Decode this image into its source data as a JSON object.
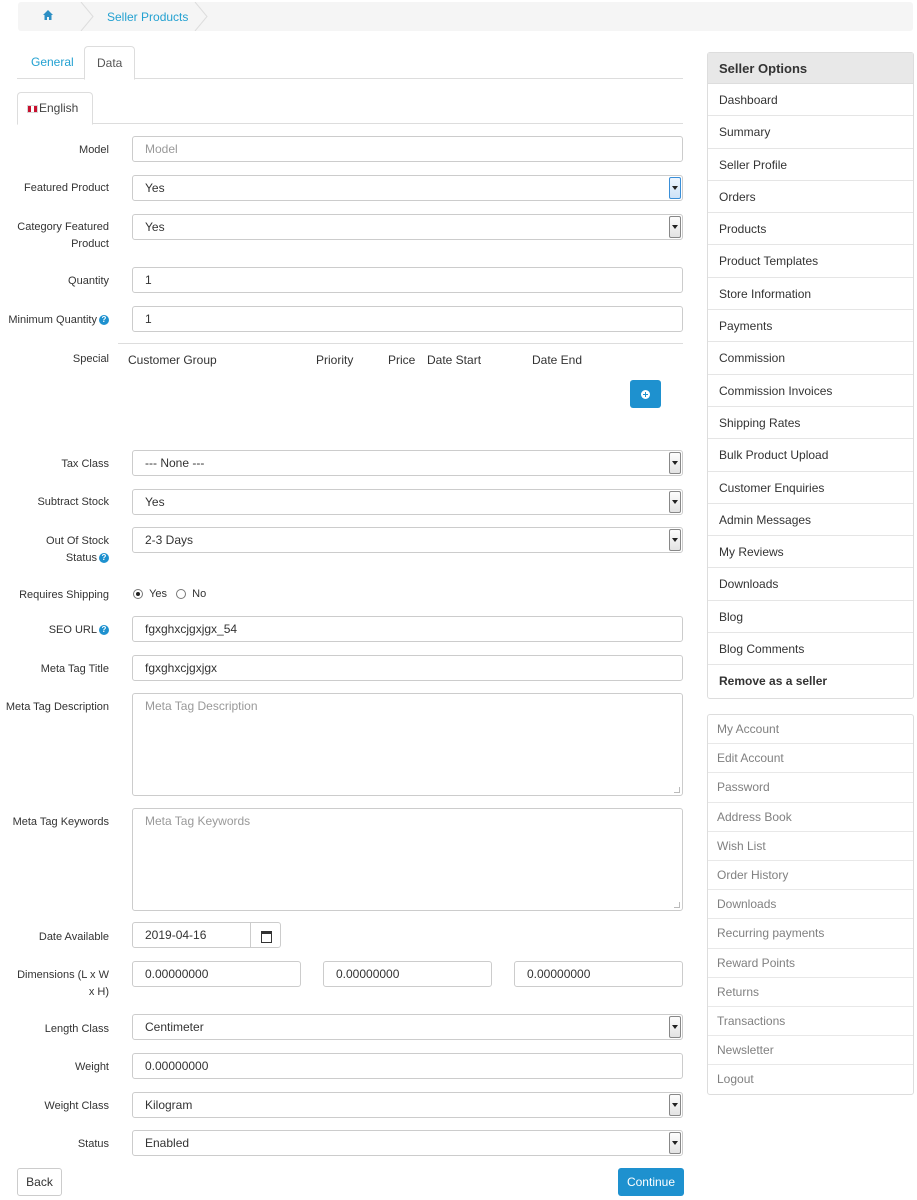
{
  "breadcrumb": {
    "home_icon": "home-icon",
    "items": [
      "Seller Products"
    ]
  },
  "tabs": [
    {
      "label": "General"
    },
    {
      "label": "Data"
    }
  ],
  "language_tab": {
    "label": "English",
    "icon": "uk-flag-icon"
  },
  "form": {
    "model": {
      "label": "Model",
      "placeholder": "Model",
      "value": ""
    },
    "featured_product": {
      "label": "Featured Product",
      "value": "Yes"
    },
    "category_featured_product": {
      "label": "Category Featured Product",
      "value": "Yes"
    },
    "quantity": {
      "label": "Quantity",
      "value": "1"
    },
    "minimum_quantity": {
      "label": "Minimum Quantity",
      "value": "1"
    },
    "special": {
      "label": "Special",
      "columns": [
        "Customer Group",
        "Priority",
        "Price",
        "Date Start",
        "Date End"
      ]
    },
    "tax_class": {
      "label": "Tax Class",
      "value": "--- None ---"
    },
    "subtract_stock": {
      "label": "Subtract Stock",
      "value": "Yes"
    },
    "out_of_stock_status": {
      "label": "Out Of Stock Status",
      "value": "2-3 Days"
    },
    "requires_shipping": {
      "label": "Requires Shipping",
      "options": [
        "Yes",
        "No"
      ],
      "selected": "Yes"
    },
    "seo_url": {
      "label": "SEO URL",
      "value": "fgxghxcjgxjgx_54"
    },
    "meta_tag_title": {
      "label": "Meta Tag Title",
      "value": "fgxghxcjgxjgx"
    },
    "meta_tag_description": {
      "label": "Meta Tag Description",
      "placeholder": "Meta Tag Description"
    },
    "meta_tag_keywords": {
      "label": "Meta Tag Keywords",
      "placeholder": "Meta Tag Keywords"
    },
    "date_available": {
      "label": "Date Available",
      "value": "2019-04-16"
    },
    "dimensions": {
      "label": "Dimensions (L x W x H)",
      "length": "0.00000000",
      "width": "0.00000000",
      "height": "0.00000000"
    },
    "length_class": {
      "label": "Length Class",
      "value": "Centimeter"
    },
    "weight": {
      "label": "Weight",
      "value": "0.00000000"
    },
    "weight_class": {
      "label": "Weight Class",
      "value": "Kilogram"
    },
    "status": {
      "label": "Status",
      "value": "Enabled"
    }
  },
  "buttons": {
    "back": "Back",
    "continue": "Continue"
  },
  "seller_options": {
    "title": "Seller Options",
    "items": [
      "Dashboard",
      "Summary",
      "Seller Profile",
      "Orders",
      "Products",
      "Product Templates",
      "Store Information",
      "Payments",
      "Commission",
      "Commission Invoices",
      "Shipping Rates",
      "Bulk Product Upload",
      "Customer Enquiries",
      "Admin Messages",
      "My Reviews",
      "Downloads",
      "Blog",
      "Blog Comments",
      "Remove as a seller"
    ]
  },
  "account_links": [
    "My Account",
    "Edit Account",
    "Password",
    "Address Book",
    "Wish List",
    "Order History",
    "Downloads",
    "Recurring payments",
    "Reward Points",
    "Returns",
    "Transactions",
    "Newsletter",
    "Logout"
  ],
  "colors": {
    "accent": "#1e91cf",
    "link": "#23a1d1"
  }
}
